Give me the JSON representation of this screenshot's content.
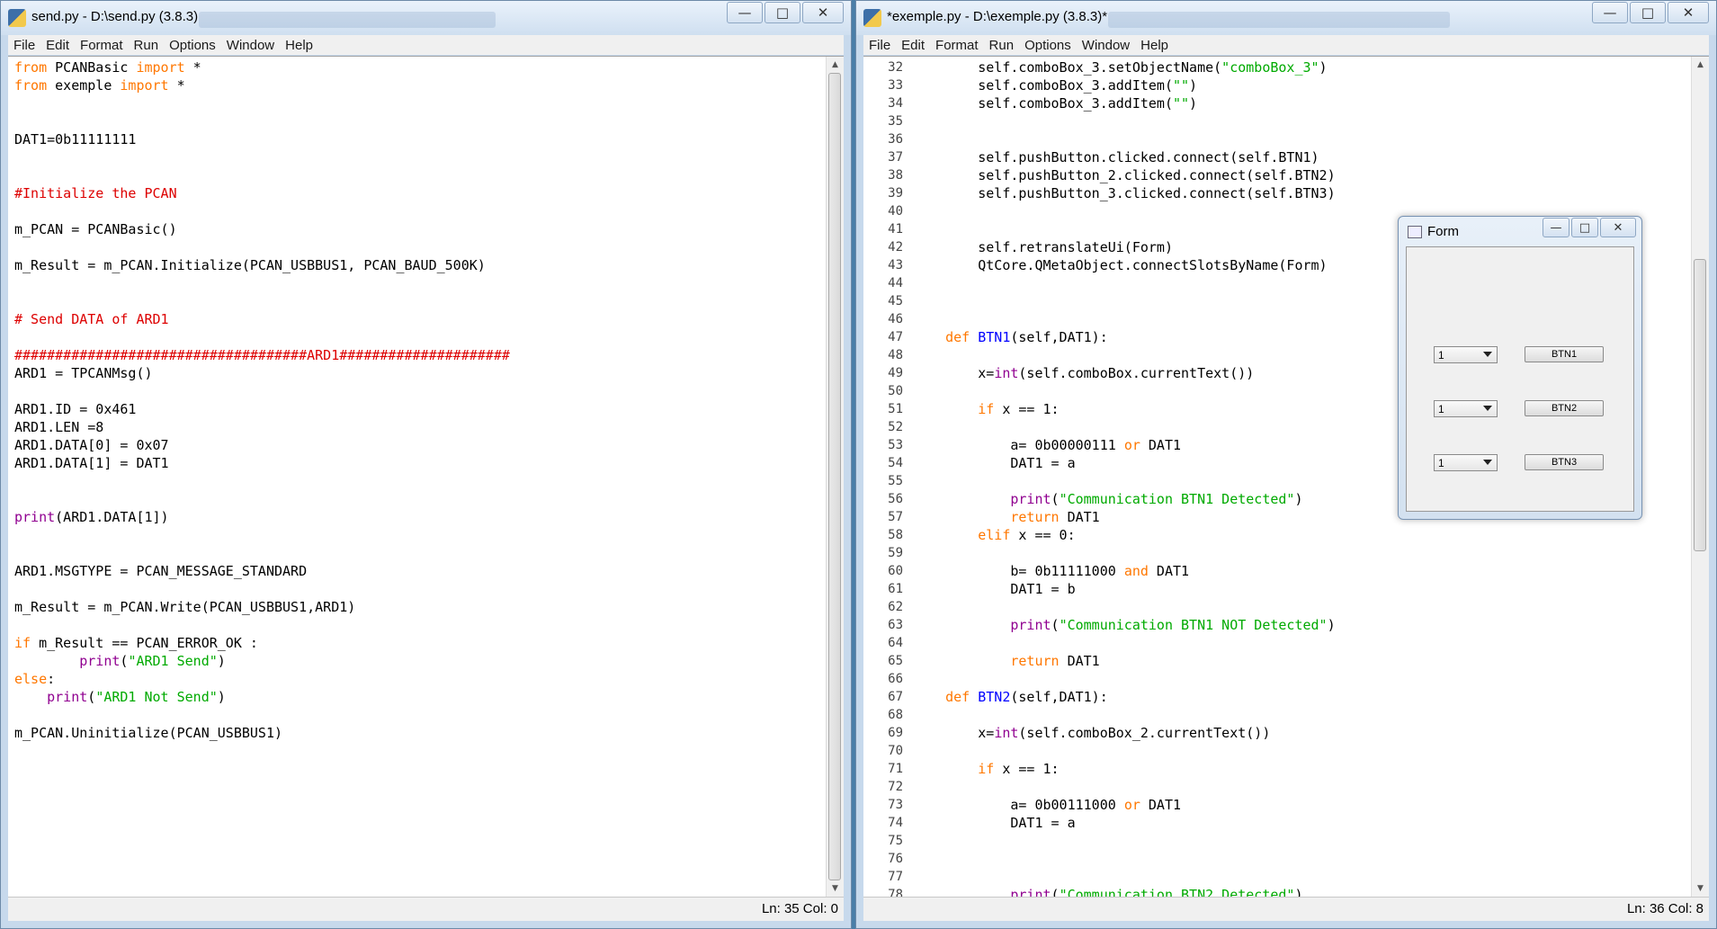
{
  "left_window": {
    "title": "send.py - D:\\send.py (3.8.3)",
    "menu": [
      "File",
      "Edit",
      "Format",
      "Run",
      "Options",
      "Window",
      "Help"
    ],
    "status": "Ln: 35   Col: 0",
    "code_lines": [
      [
        {
          "t": "from",
          "c": "kw"
        },
        {
          "t": " PCANBasic "
        },
        {
          "t": "import",
          "c": "kw"
        },
        {
          "t": " *"
        }
      ],
      [
        {
          "t": "from",
          "c": "kw"
        },
        {
          "t": " exemple "
        },
        {
          "t": "import",
          "c": "kw"
        },
        {
          "t": " *"
        }
      ],
      [],
      [],
      [
        {
          "t": "DAT1=0b11111111"
        }
      ],
      [],
      [],
      [
        {
          "t": "#Initialize the PCAN",
          "c": "cm"
        }
      ],
      [],
      [
        {
          "t": "m_PCAN = PCANBasic()"
        }
      ],
      [],
      [
        {
          "t": "m_Result = m_PCAN.Initialize(PCAN_USBBUS1, PCAN_BAUD_500K)"
        }
      ],
      [],
      [],
      [
        {
          "t": "# Send DATA of ARD1",
          "c": "cm"
        }
      ],
      [],
      [
        {
          "t": "####################################ARD1#####################",
          "c": "cm"
        }
      ],
      [
        {
          "t": "ARD1 = TPCANMsg()"
        }
      ],
      [],
      [
        {
          "t": "ARD1.ID = 0x461"
        }
      ],
      [
        {
          "t": "ARD1.LEN =8"
        }
      ],
      [
        {
          "t": "ARD1.DATA[0] = 0x07"
        }
      ],
      [
        {
          "t": "ARD1.DATA[1] = DAT1"
        }
      ],
      [],
      [],
      [
        {
          "t": "print",
          "c": "bi"
        },
        {
          "t": "(ARD1.DATA[1])"
        }
      ],
      [],
      [],
      [
        {
          "t": "ARD1.MSGTYPE = PCAN_MESSAGE_STANDARD"
        }
      ],
      [],
      [
        {
          "t": "m_Result = m_PCAN.Write(PCAN_USBBUS1,ARD1)"
        }
      ],
      [],
      [
        {
          "t": "if",
          "c": "kw"
        },
        {
          "t": " m_Result == PCAN_ERROR_OK :"
        }
      ],
      [
        {
          "t": "        "
        },
        {
          "t": "print",
          "c": "bi"
        },
        {
          "t": "("
        },
        {
          "t": "\"ARD1 Send\"",
          "c": "str"
        },
        {
          "t": ")"
        }
      ],
      [
        {
          "t": "else",
          "c": "kw"
        },
        {
          "t": ":"
        }
      ],
      [
        {
          "t": "    "
        },
        {
          "t": "print",
          "c": "bi"
        },
        {
          "t": "("
        },
        {
          "t": "\"ARD1 Not Send\"",
          "c": "str"
        },
        {
          "t": ")"
        }
      ],
      [],
      [
        {
          "t": "m_PCAN.Uninitialize(PCAN_USBBUS1)"
        }
      ]
    ]
  },
  "right_window": {
    "title": "*exemple.py - D:\\exemple.py (3.8.3)*",
    "menu": [
      "File",
      "Edit",
      "Format",
      "Run",
      "Options",
      "Window",
      "Help"
    ],
    "status": "Ln: 36   Col: 8",
    "line_numbers": [
      "32",
      "33",
      "34",
      "35",
      "36",
      "37",
      "38",
      "39",
      "40",
      "41",
      "42",
      "43",
      "44",
      "45",
      "46",
      "47",
      "48",
      "49",
      "50",
      "51",
      "52",
      "53",
      "54",
      "55",
      "56",
      "57",
      "58",
      "59",
      "60",
      "61",
      "62",
      "63",
      "64",
      "65",
      "66",
      "67",
      "68",
      "69",
      "70",
      "71",
      "72",
      "73",
      "74",
      "75",
      "76",
      "77",
      "78"
    ],
    "code_lines": [
      [
        {
          "t": "        self.comboBox_3.setObjectName("
        },
        {
          "t": "\"comboBox_3\"",
          "c": "str"
        },
        {
          "t": ")"
        }
      ],
      [
        {
          "t": "        self.comboBox_3.addItem("
        },
        {
          "t": "\"\"",
          "c": "str"
        },
        {
          "t": ")"
        }
      ],
      [
        {
          "t": "        self.comboBox_3.addItem("
        },
        {
          "t": "\"\"",
          "c": "str"
        },
        {
          "t": ")"
        }
      ],
      [],
      [],
      [
        {
          "t": "        self.pushButton.clicked.connect(self.BTN1)"
        }
      ],
      [
        {
          "t": "        self.pushButton_2.clicked.connect(self.BTN2)"
        }
      ],
      [
        {
          "t": "        self.pushButton_3.clicked.connect(self.BTN3)"
        }
      ],
      [],
      [],
      [
        {
          "t": "        self.retranslateUi(Form)"
        }
      ],
      [
        {
          "t": "        QtCore.QMetaObject.connectSlotsByName(Form)"
        }
      ],
      [],
      [],
      [],
      [
        {
          "t": "    "
        },
        {
          "t": "def",
          "c": "kw"
        },
        {
          "t": " "
        },
        {
          "t": "BTN1",
          "c": "def"
        },
        {
          "t": "(self,DAT1):"
        }
      ],
      [],
      [
        {
          "t": "        x="
        },
        {
          "t": "int",
          "c": "bi"
        },
        {
          "t": "(self.comboBox.currentText())"
        }
      ],
      [],
      [
        {
          "t": "        "
        },
        {
          "t": "if",
          "c": "kw"
        },
        {
          "t": " x == 1:"
        }
      ],
      [],
      [
        {
          "t": "            a= 0b00000111 "
        },
        {
          "t": "or",
          "c": "kw"
        },
        {
          "t": " DAT1"
        }
      ],
      [
        {
          "t": "            DAT1 = a"
        }
      ],
      [],
      [
        {
          "t": "            "
        },
        {
          "t": "print",
          "c": "bi"
        },
        {
          "t": "("
        },
        {
          "t": "\"Communication BTN1 Detected\"",
          "c": "str"
        },
        {
          "t": ")"
        }
      ],
      [
        {
          "t": "            "
        },
        {
          "t": "return",
          "c": "kw"
        },
        {
          "t": " DAT1"
        }
      ],
      [
        {
          "t": "        "
        },
        {
          "t": "elif",
          "c": "kw"
        },
        {
          "t": " x == 0:"
        }
      ],
      [],
      [
        {
          "t": "            b= 0b11111000 "
        },
        {
          "t": "and",
          "c": "kw"
        },
        {
          "t": " DAT1"
        }
      ],
      [
        {
          "t": "            DAT1 = b"
        }
      ],
      [],
      [
        {
          "t": "            "
        },
        {
          "t": "print",
          "c": "bi"
        },
        {
          "t": "("
        },
        {
          "t": "\"Communication BTN1 NOT Detected\"",
          "c": "str"
        },
        {
          "t": ")"
        }
      ],
      [],
      [
        {
          "t": "            "
        },
        {
          "t": "return",
          "c": "kw"
        },
        {
          "t": " DAT1"
        }
      ],
      [],
      [
        {
          "t": "    "
        },
        {
          "t": "def",
          "c": "kw"
        },
        {
          "t": " "
        },
        {
          "t": "BTN2",
          "c": "def"
        },
        {
          "t": "(self,DAT1):"
        }
      ],
      [],
      [
        {
          "t": "        x="
        },
        {
          "t": "int",
          "c": "bi"
        },
        {
          "t": "(self.comboBox_2.currentText())"
        }
      ],
      [],
      [
        {
          "t": "        "
        },
        {
          "t": "if",
          "c": "kw"
        },
        {
          "t": " x == 1:"
        }
      ],
      [],
      [
        {
          "t": "            a= 0b00111000 "
        },
        {
          "t": "or",
          "c": "kw"
        },
        {
          "t": " DAT1"
        }
      ],
      [
        {
          "t": "            DAT1 = a"
        }
      ],
      [],
      [],
      [],
      [
        {
          "t": "            "
        },
        {
          "t": "print",
          "c": "bi"
        },
        {
          "t": "("
        },
        {
          "t": "\"Communication BTN2 Detected\"",
          "c": "str"
        },
        {
          "t": ")"
        }
      ]
    ]
  },
  "form_window": {
    "title": "Form",
    "rows": [
      {
        "combo_value": "1",
        "button_label": "BTN1"
      },
      {
        "combo_value": "1",
        "button_label": "BTN2"
      },
      {
        "combo_value": "1",
        "button_label": "BTN3"
      }
    ]
  },
  "colors": {
    "keyword": "#ff7700",
    "builtin": "#900090",
    "string": "#00aa00",
    "comment": "#dd0000",
    "definition": "#0000ff"
  }
}
